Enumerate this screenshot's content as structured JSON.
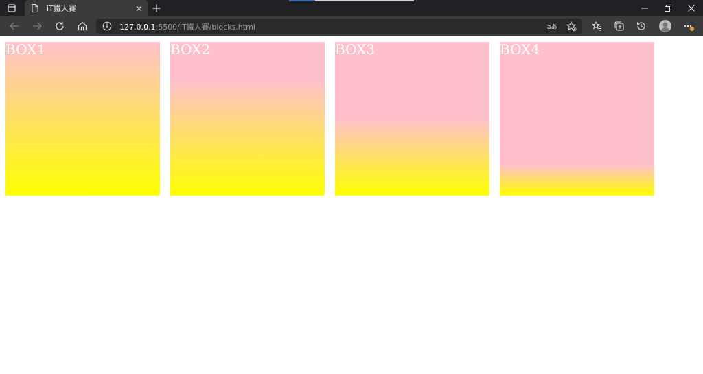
{
  "browser": {
    "tab": {
      "title": "iT鐵人賽"
    },
    "address": {
      "host": "127.0.0.1",
      "path": ":5500/iT鐵人賽/blocks.html"
    },
    "icons": [
      "window-menu-icon",
      "page-icon",
      "close-icon",
      "plus-icon",
      "minimize-icon",
      "restore-icon",
      "close-window-icon",
      "back-icon",
      "forward-icon",
      "reload-icon",
      "home-icon",
      "info-icon",
      "read-aloud-icon",
      "add-favorite-icon",
      "favorites-icon",
      "collections-icon",
      "history-icon",
      "profile-avatar",
      "more-icon"
    ],
    "accent": "#3a6ea5"
  },
  "boxes": [
    {
      "label": "BOX1"
    },
    {
      "label": "BOX2"
    },
    {
      "label": "BOX3"
    },
    {
      "label": "BOX4"
    }
  ],
  "colors": {
    "gradient_top": "#ffc0cb",
    "gradient_bottom": "#ffff00",
    "label": "#ffffff"
  }
}
